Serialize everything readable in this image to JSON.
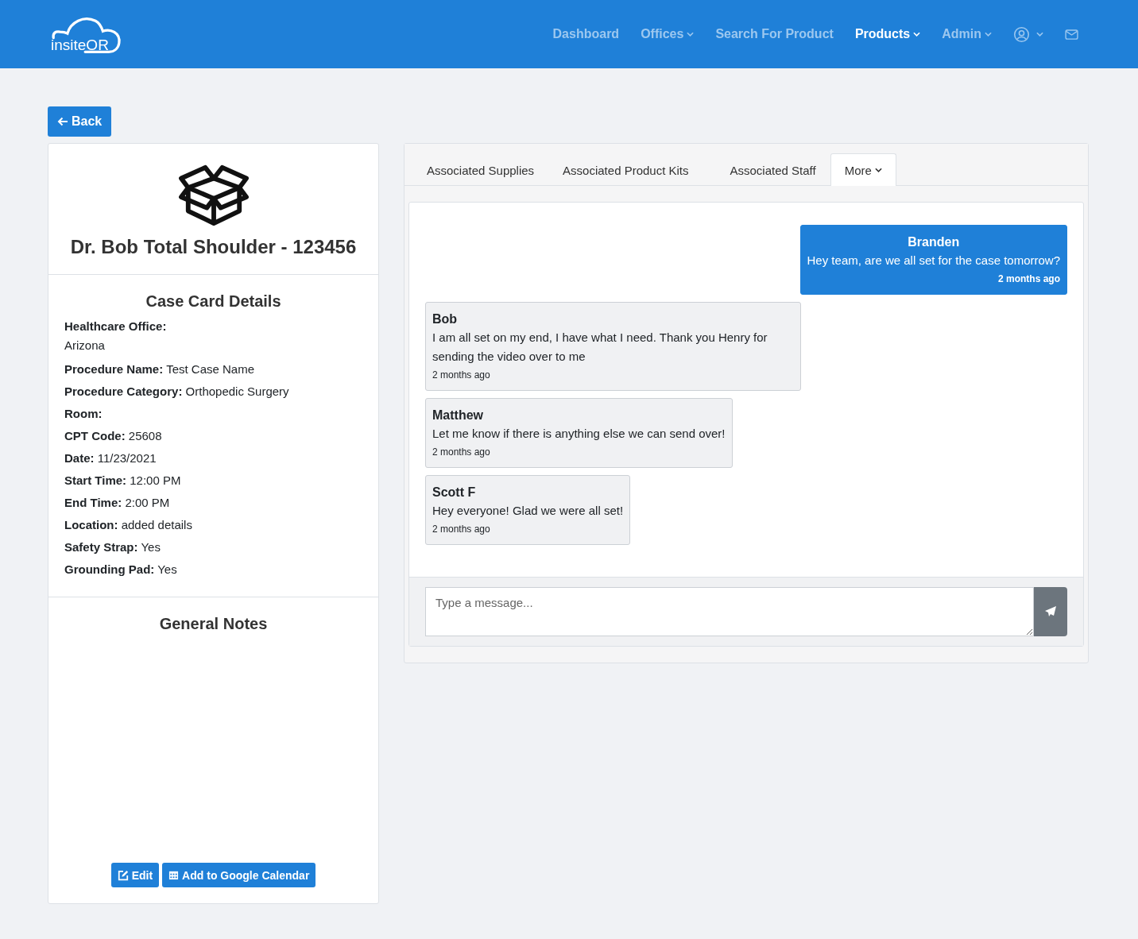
{
  "header": {
    "logo": "insiteOR",
    "nav": [
      {
        "label": "Dashboard",
        "selected": false,
        "dropdown": false
      },
      {
        "label": "Offices",
        "selected": false,
        "dropdown": true
      },
      {
        "label": "Search For Product",
        "selected": false,
        "dropdown": false
      },
      {
        "label": "Products",
        "selected": true,
        "dropdown": true
      },
      {
        "label": "Admin",
        "selected": false,
        "dropdown": true
      }
    ]
  },
  "back_button": "Back",
  "case_card": {
    "title": "Dr. Bob Total Shoulder - 123456",
    "details_heading": "Case Card Details",
    "details": [
      {
        "label": "Healthcare Office:",
        "value": "Arizona",
        "stacked": true
      },
      {
        "label": "Procedure Name:",
        "value": "Test Case Name",
        "stacked": false
      },
      {
        "label": "Procedure Category:",
        "value": "Orthopedic Surgery",
        "stacked": false
      },
      {
        "label": "Room:",
        "stacked": false
      },
      {
        "label": "CPT Code:",
        "value": "25608",
        "stacked": false
      },
      {
        "label": "Date:",
        "value": "11/23/2021",
        "stacked": false
      },
      {
        "label": "Start Time:",
        "value": "12:00 PM",
        "stacked": false
      },
      {
        "label": "End Time:",
        "value": "2:00 PM",
        "stacked": false
      },
      {
        "label": "Location:",
        "value": "added details",
        "stacked": false
      },
      {
        "label": "Safety Strap:",
        "value": "Yes",
        "stacked": false
      },
      {
        "label": "Grounding Pad:",
        "value": "Yes",
        "stacked": false
      }
    ],
    "notes_heading": "General Notes",
    "buttons": [
      {
        "label": "Edit",
        "kind": "edit"
      },
      {
        "label": "Add to Google Calendar",
        "kind": "calendar"
      }
    ]
  },
  "tabs": [
    {
      "label": "Associated Supplies",
      "selected": false,
      "dropdown": false
    },
    {
      "label": "Associated Product Kits",
      "selected": false,
      "dropdown": false
    },
    {
      "label": "Associated Staff",
      "selected": false,
      "dropdown": false
    },
    {
      "label": "More",
      "selected": true,
      "dropdown": true
    }
  ],
  "messages": [
    {
      "author": "Branden",
      "text": "Hey team, are we all set for the case tomorrow?",
      "time": "2 months ago",
      "own": true
    },
    {
      "author": "Bob",
      "text": "I am all set on my end, I have what I need. Thank you Henry for sending the video over to me",
      "time": "2 months ago",
      "own": false
    },
    {
      "author": "Matthew",
      "text": "Let me know if there is anything else we can send over!",
      "time": "2 months ago",
      "own": false
    },
    {
      "author": "Scott F",
      "text": "Hey everyone! Glad we were all set!",
      "time": "2 months ago",
      "own": false
    }
  ],
  "composer": {
    "placeholder": "Type a message..."
  }
}
